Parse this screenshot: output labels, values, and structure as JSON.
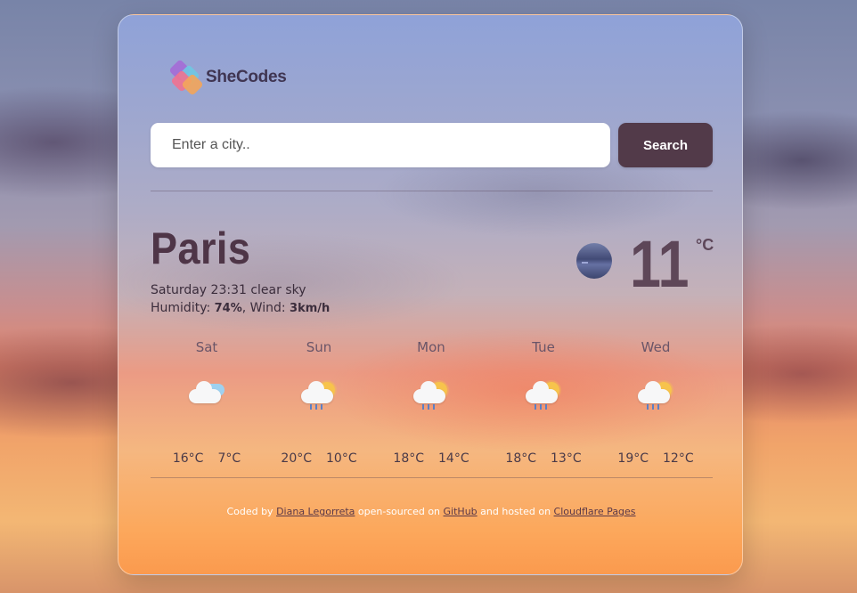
{
  "logo": {
    "text": "SheCodes"
  },
  "search": {
    "placeholder": "Enter a city..",
    "button_label": "Search"
  },
  "current": {
    "city": "Paris",
    "datetime": "Saturday 23:31",
    "description": "clear sky",
    "humidity_label": "Humidity: ",
    "humidity": "74%",
    "wind_label": ", Wind: ",
    "wind": "3km/h",
    "temperature": "11",
    "unit": "°C",
    "icon": "clear-night-icon"
  },
  "forecast": [
    {
      "day": "Sat",
      "icon": "partly-cloudy-icon",
      "max": "16°C",
      "min": "7°C"
    },
    {
      "day": "Sun",
      "icon": "sun-rain-icon",
      "max": "20°C",
      "min": "10°C"
    },
    {
      "day": "Mon",
      "icon": "sun-rain-icon",
      "max": "18°C",
      "min": "14°C"
    },
    {
      "day": "Tue",
      "icon": "sun-rain-icon",
      "max": "18°C",
      "min": "13°C"
    },
    {
      "day": "Wed",
      "icon": "sun-rain-icon",
      "max": "19°C",
      "min": "12°C"
    }
  ],
  "footer": {
    "prefix": "Coded by ",
    "author": "Diana Legorreta",
    "middle1": " open-sourced on ",
    "github": "GitHub",
    "middle2": " and hosted on ",
    "host": "Cloudflare Pages"
  }
}
